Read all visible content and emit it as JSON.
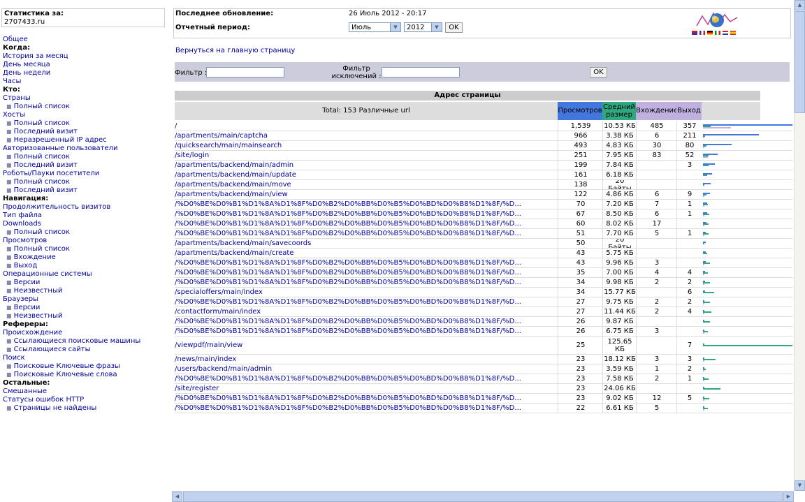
{
  "sidebar": {
    "stat_title": "Статистика за:",
    "site": "2707433.ru",
    "menu": [
      {
        "t": "link",
        "label": "Общее"
      },
      {
        "t": "h",
        "label": "Когда:"
      },
      {
        "t": "link",
        "label": "История за месяц"
      },
      {
        "t": "link",
        "label": "День месяца"
      },
      {
        "t": "link",
        "label": "День недели"
      },
      {
        "t": "link",
        "label": "Часы"
      },
      {
        "t": "h",
        "label": "Кто:"
      },
      {
        "t": "link",
        "label": "Страны"
      },
      {
        "t": "sub",
        "label": "Полный список"
      },
      {
        "t": "link",
        "label": "Хосты"
      },
      {
        "t": "sub",
        "label": "Полный список"
      },
      {
        "t": "sub",
        "label": "Последний визит"
      },
      {
        "t": "sub",
        "label": "Неразрешенный IP адрес"
      },
      {
        "t": "link",
        "label": "Авторизованные пользователи"
      },
      {
        "t": "sub",
        "label": "Полный список"
      },
      {
        "t": "sub",
        "label": "Последний визит"
      },
      {
        "t": "link",
        "label": "Роботы/Пауки посетители"
      },
      {
        "t": "sub",
        "label": "Полный список"
      },
      {
        "t": "sub",
        "label": "Последний визит"
      },
      {
        "t": "h",
        "label": "Навигация:"
      },
      {
        "t": "link",
        "label": "Продолжительность визитов"
      },
      {
        "t": "link",
        "label": "Тип файла"
      },
      {
        "t": "link",
        "label": "Downloads"
      },
      {
        "t": "sub",
        "label": "Полный список"
      },
      {
        "t": "link",
        "label": "Просмотров"
      },
      {
        "t": "sub",
        "label": "Полный список"
      },
      {
        "t": "sub",
        "label": "Вхождение"
      },
      {
        "t": "sub",
        "label": "Выход"
      },
      {
        "t": "link",
        "label": "Операционные системы"
      },
      {
        "t": "sub",
        "label": "Версии"
      },
      {
        "t": "sub",
        "label": "Неизвестный"
      },
      {
        "t": "link",
        "label": "Браузеры"
      },
      {
        "t": "sub",
        "label": "Версии"
      },
      {
        "t": "sub",
        "label": "Неизвестный"
      },
      {
        "t": "h",
        "label": "Рефереры:"
      },
      {
        "t": "link",
        "label": "Происхождение"
      },
      {
        "t": "sub",
        "label": "Ссылающиеся поисковые машины"
      },
      {
        "t": "sub",
        "label": "Ссылающиеся сайты"
      },
      {
        "t": "link",
        "label": "Поиск"
      },
      {
        "t": "sub",
        "label": "Поисковые Ключевые фразы"
      },
      {
        "t": "sub",
        "label": "Поисковые Ключевые слова"
      },
      {
        "t": "h",
        "label": "Остальные:"
      },
      {
        "t": "link",
        "label": "Смешанные"
      },
      {
        "t": "link",
        "label": "Статусы ошибок HTTP"
      },
      {
        "t": "sub",
        "label": "Страницы не найдены"
      }
    ]
  },
  "header": {
    "last_update_label": "Последнее обновление:",
    "last_update_value": "26 Июль 2012 - 20:17",
    "period_label": "Отчетный период:",
    "month": "Июль",
    "year": "2012",
    "ok": "OK",
    "back_link": "Вернуться на главную страницу"
  },
  "filter": {
    "filter_label": "Фильтр :",
    "exclude_label_1": "Фильтр",
    "exclude_label_2": "исключений :",
    "ok": "OK"
  },
  "table": {
    "caption": "Адрес страницы",
    "total": "Total: 153 Различные url",
    "col_views": "Просмотров",
    "col_size": "Средний размер",
    "col_entry": "Вхождение",
    "col_exit": "Выход",
    "colors": {
      "views": "#4477dd",
      "size": "#2ea87e",
      "entry": "#c0b0e0",
      "exit": "#c0b0e0"
    },
    "rows": [
      {
        "url": "/",
        "views": "1,539",
        "size": "10.53 КБ",
        "entry": "485",
        "exit": "357"
      },
      {
        "url": "/apartments/main/captcha",
        "views": "966",
        "size": "3.38 КБ",
        "entry": "6",
        "exit": "211"
      },
      {
        "url": "/quicksearch/main/mainsearch",
        "views": "493",
        "size": "4.83 КБ",
        "entry": "30",
        "exit": "80"
      },
      {
        "url": "/site/login",
        "views": "251",
        "size": "7.95 КБ",
        "entry": "83",
        "exit": "52"
      },
      {
        "url": "/apartments/backend/main/admin",
        "views": "199",
        "size": "7.84 КБ",
        "entry": "",
        "exit": "3"
      },
      {
        "url": "/apartments/backend/main/update",
        "views": "161",
        "size": "6.18 КБ",
        "entry": "",
        "exit": ""
      },
      {
        "url": "/apartments/backend/main/move",
        "views": "138",
        "size": "20 Байты",
        "entry": "",
        "exit": ""
      },
      {
        "url": "/apartments/backend/main/view",
        "views": "122",
        "size": "4.86 КБ",
        "entry": "6",
        "exit": "9"
      },
      {
        "url": "/%D0%BE%D0%B1%D1%8A%D1%8F%D0%B2%D0%BB%D0%B5%D0%BD%D0%B8%D1%8F/%D...",
        "views": "70",
        "size": "7.20 КБ",
        "entry": "7",
        "exit": "1"
      },
      {
        "url": "/%D0%BE%D0%B1%D1%8A%D1%8F%D0%B2%D0%BB%D0%B5%D0%BD%D0%B8%D1%8F/%D...",
        "views": "67",
        "size": "8.50 КБ",
        "entry": "6",
        "exit": "1"
      },
      {
        "url": "/%D0%BE%D0%B1%D1%8A%D1%8F%D0%B2%D0%BB%D0%B5%D0%BD%D0%B8%D1%8F/%D...",
        "views": "60",
        "size": "8.02 КБ",
        "entry": "17",
        "exit": ""
      },
      {
        "url": "/%D0%BE%D0%B1%D1%8A%D1%8F%D0%B2%D0%BB%D0%B5%D0%BD%D0%B8%D1%8F/%D...",
        "views": "51",
        "size": "7.70 КБ",
        "entry": "5",
        "exit": "1"
      },
      {
        "url": "/apartments/backend/main/savecoords",
        "views": "50",
        "size": "20 Байты",
        "entry": "",
        "exit": ""
      },
      {
        "url": "/apartments/backend/main/create",
        "views": "43",
        "size": "5.75 КБ",
        "entry": "",
        "exit": ""
      },
      {
        "url": "/%D0%BE%D0%B1%D1%8A%D1%8F%D0%B2%D0%BB%D0%B5%D0%BD%D0%B8%D1%8F/%D...",
        "views": "43",
        "size": "9.96 КБ",
        "entry": "3",
        "exit": ""
      },
      {
        "url": "/%D0%BE%D0%B1%D1%8A%D1%8F%D0%B2%D0%BB%D0%B5%D0%BD%D0%B8%D1%8F/%D...",
        "views": "35",
        "size": "7.00 КБ",
        "entry": "4",
        "exit": "4"
      },
      {
        "url": "/%D0%BE%D0%B1%D1%8A%D1%8F%D0%B2%D0%BB%D0%B5%D0%BD%D0%B8%D1%8F/%D...",
        "views": "34",
        "size": "9.98 КБ",
        "entry": "2",
        "exit": "2"
      },
      {
        "url": "/specialoffers/main/index",
        "views": "34",
        "size": "15.77 КБ",
        "entry": "",
        "exit": "6"
      },
      {
        "url": "/%D0%BE%D0%B1%D1%8A%D1%8F%D0%B2%D0%BB%D0%B5%D0%BD%D0%B8%D1%8F/%D...",
        "views": "27",
        "size": "9.75 КБ",
        "entry": "2",
        "exit": "2"
      },
      {
        "url": "/contactform/main/index",
        "views": "27",
        "size": "11.44 КБ",
        "entry": "2",
        "exit": "4"
      },
      {
        "url": "/%D0%BE%D0%B1%D1%8A%D1%8F%D0%B2%D0%BB%D0%B5%D0%BD%D0%B8%D1%8F/%D...",
        "views": "26",
        "size": "9.87 КБ",
        "entry": "",
        "exit": ""
      },
      {
        "url": "/%D0%BE%D0%B1%D1%8A%D1%8F%D0%B2%D0%BB%D0%B5%D0%BD%D0%B8%D1%8F/%D...",
        "views": "26",
        "size": "6.75 КБ",
        "entry": "3",
        "exit": ""
      },
      {
        "url": "/viewpdf/main/view",
        "views": "25",
        "size": "125.65 КБ",
        "entry": "",
        "exit": "7"
      },
      {
        "url": "/news/main/index",
        "views": "23",
        "size": "18.12 КБ",
        "entry": "3",
        "exit": "3"
      },
      {
        "url": "/users/backend/main/admin",
        "views": "23",
        "size": "3.59 КБ",
        "entry": "1",
        "exit": "2"
      },
      {
        "url": "/%D0%BE%D0%B1%D1%8A%D1%8F%D0%B2%D0%BB%D0%B5%D0%BD%D0%B8%D1%8F/%D...",
        "views": "23",
        "size": "7.58 КБ",
        "entry": "2",
        "exit": "1"
      },
      {
        "url": "/site/register",
        "views": "23",
        "size": "24.06 КБ",
        "entry": "",
        "exit": ""
      },
      {
        "url": "/%D0%BE%D0%B1%D1%8A%D1%8F%D0%B2%D0%BB%D0%B5%D0%BD%D0%B8%D1%8F/%D...",
        "views": "23",
        "size": "9.02 КБ",
        "entry": "12",
        "exit": "5"
      },
      {
        "url": "/%D0%BE%D0%B1%D1%8A%D1%8F%D0%B2%D0%BB%D0%B5%D0%BD%D0%B8%D1%8F/%D...",
        "views": "22",
        "size": "6.61 КБ",
        "entry": "5",
        "exit": ""
      }
    ]
  }
}
